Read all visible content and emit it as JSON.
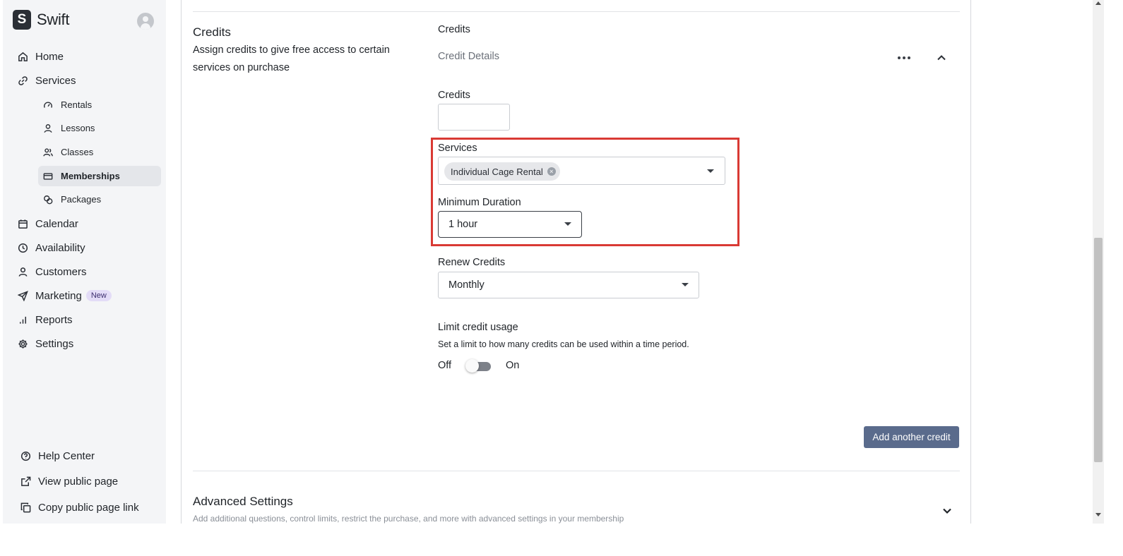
{
  "brand": {
    "name": "Swift",
    "logo_letter": "S"
  },
  "nav": {
    "home": "Home",
    "services": "Services",
    "sub_items": [
      "Rentals",
      "Lessons",
      "Classes",
      "Memberships",
      "Packages"
    ],
    "calendar": "Calendar",
    "availability": "Availability",
    "customers": "Customers",
    "marketing": "Marketing",
    "marketing_badge": "New",
    "reports": "Reports",
    "settings": "Settings"
  },
  "footer_links": {
    "help": "Help Center",
    "view_public": "View public page",
    "copy_link": "Copy public page link"
  },
  "credits_section": {
    "title": "Credits",
    "description": "Assign credits to give free access to certain services on purchase",
    "group_label": "Credits",
    "details_label": "Credit Details",
    "credits_label": "Credits",
    "credits_value": "",
    "services_label": "Services",
    "services_chip": "Individual Cage Rental",
    "min_duration_label": "Minimum Duration",
    "min_duration_value": "1 hour",
    "renew_label": "Renew Credits",
    "renew_value": "Monthly",
    "limit_label": "Limit credit usage",
    "limit_desc": "Set a limit to how many credits can be used within a time period.",
    "toggle_off": "Off",
    "toggle_on": "On",
    "toggle_state": "off",
    "add_button": "Add another credit"
  },
  "advanced": {
    "title": "Advanced Settings",
    "description": "Add additional questions, control limits, restrict the purchase, and more with advanced settings in your membership"
  },
  "colors": {
    "highlight": "#d93a34",
    "add_button": "#5a6b8c",
    "badge_bg": "#e3dcf7",
    "sidebar_bg": "#f4f5f7"
  }
}
